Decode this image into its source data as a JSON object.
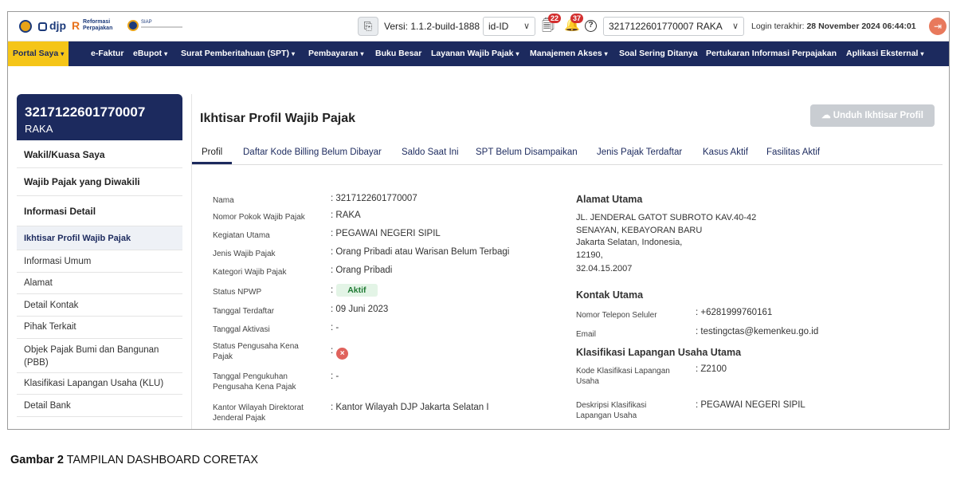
{
  "header": {
    "version_label": "Versi: 1.1.2-build-1888",
    "language": "id-ID",
    "notif_count_1": "22",
    "notif_count_2": "37",
    "account_select": "3217122601770007 RAKA",
    "login_label": "Login terakhir:",
    "login_time": "28 November 2024 06:44:01",
    "logos": {
      "djp": "djp",
      "reformasi_1": "Reformasi",
      "reformasi_2": "Perpajakan",
      "siap": "SIAP"
    }
  },
  "nav": {
    "items": [
      {
        "label": "Portal Saya",
        "caret": "▾"
      },
      {
        "label": "e-Faktur",
        "caret": ""
      },
      {
        "label": "eBupot",
        "caret": "▾"
      },
      {
        "label": "Surat Pemberitahuan (SPT)",
        "caret": "▾"
      },
      {
        "label": "Pembayaran",
        "caret": "▾"
      },
      {
        "label": "Buku Besar",
        "caret": ""
      },
      {
        "label": "Layanan Wajib Pajak",
        "caret": "▾"
      },
      {
        "label": "Manajemen Akses",
        "caret": "▾"
      },
      {
        "label": "Soal Sering Ditanya",
        "caret": ""
      },
      {
        "label": "Pertukaran Informasi Perpajakan",
        "caret": ""
      },
      {
        "label": "Aplikasi Eksternal",
        "caret": "▾"
      }
    ]
  },
  "sidebar": {
    "npwp": "3217122601770007",
    "name": "RAKA",
    "items": [
      {
        "label": "Wakil/Kuasa Saya"
      },
      {
        "label": "Wajib Pajak yang Diwakili"
      },
      {
        "label": "Informasi Detail"
      },
      {
        "label": "Ikhtisar Profil Wajib Pajak"
      },
      {
        "label": "Informasi Umum"
      },
      {
        "label": "Alamat"
      },
      {
        "label": "Detail Kontak"
      },
      {
        "label": "Pihak Terkait"
      },
      {
        "label": "Objek Pajak Bumi dan Bangunan (PBB)"
      },
      {
        "label": "Klasifikasi Lapangan Usaha (KLU)"
      },
      {
        "label": "Detail Bank"
      }
    ]
  },
  "main": {
    "title": "Ikhtisar Profil Wajib Pajak",
    "download_button": "Unduh Ikhtisar Profil",
    "tabs": [
      {
        "label": "Profil"
      },
      {
        "label": "Daftar Kode Billing Belum Dibayar"
      },
      {
        "label": "Saldo Saat Ini"
      },
      {
        "label": "SPT Belum Disampaikan"
      },
      {
        "label": "Jenis Pajak Terdaftar"
      },
      {
        "label": "Kasus Aktif"
      },
      {
        "label": "Fasilitas Aktif"
      }
    ],
    "profile": [
      {
        "label": "Nama",
        "value": ": 3217122601770007"
      },
      {
        "label": "Nomor Pokok Wajib Pajak",
        "value": ": RAKA"
      },
      {
        "label": "Kegiatan Utama",
        "value": ": PEGAWAI NEGERI SIPIL"
      },
      {
        "label": "Jenis Wajib Pajak",
        "value": ": Orang Pribadi atau Warisan Belum Terbagi"
      },
      {
        "label": "Kategori Wajib Pajak",
        "value": ": Orang Pribadi"
      },
      {
        "label": "Status NPWP",
        "value": ":",
        "badge": "Aktif"
      },
      {
        "label": "Tanggal Terdaftar",
        "value": ": 09 Juni 2023"
      },
      {
        "label": "Tanggal Aktivasi",
        "value": ": -"
      },
      {
        "label": "Status Pengusaha Kena Pajak",
        "value": ":"
      },
      {
        "label": "Tanggal Pengukuhan Pengusaha Kena Pajak",
        "value": ": -"
      },
      {
        "label": "Kantor Wilayah Direktorat Jenderal Pajak",
        "value": ": Kantor Wilayah DJP Jakarta Selatan I"
      }
    ],
    "alamat": {
      "title": "Alamat Utama",
      "lines": [
        "JL. JENDERAL GATOT SUBROTO KAV.40-42",
        "SENAYAN, KEBAYORAN BARU",
        "Jakarta Selatan, Indonesia,",
        "12190,",
        "32.04.15.2007"
      ]
    },
    "kontak": {
      "title": "Kontak Utama",
      "phone_label": "Nomor Telepon Seluler",
      "phone_value": ": +6281999760161",
      "email_label": "Email",
      "email_value": ": testingctas@kemenkeu.go.id"
    },
    "klu": {
      "title": "Klasifikasi Lapangan Usaha Utama",
      "kode_label": "Kode Klasifikasi Lapangan Usaha",
      "kode_value": ": Z2100",
      "desk_label": "Deskripsi Klasifikasi Lapangan Usaha",
      "desk_value": ": PEGAWAI NEGERI SIPIL"
    }
  },
  "caption": {
    "prefix": "Gambar 2",
    "text": "TAMPILAN DASHBOARD CORETAX"
  }
}
